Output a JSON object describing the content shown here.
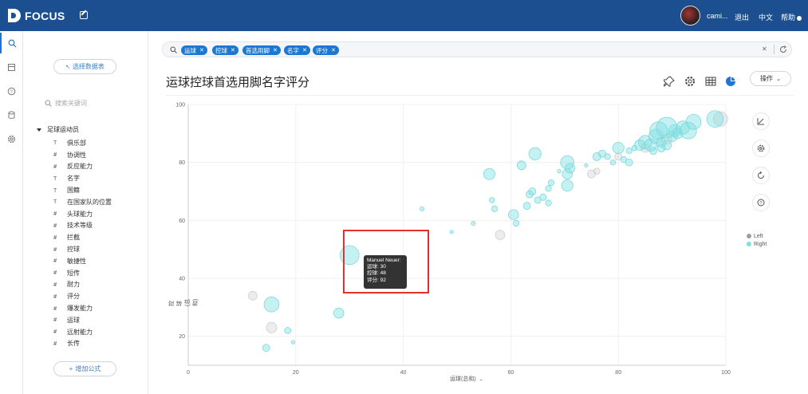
{
  "header": {
    "app_name": "FOCUS",
    "username": "cami...",
    "logout": "退出",
    "language": "中文",
    "help": "帮助"
  },
  "sidebar": {
    "select_table_button": "选择数据表",
    "search_placeholder": "搜索关键词",
    "root_label": "足球运动员",
    "fields": [
      {
        "icon": "T",
        "label": "俱乐部"
      },
      {
        "icon": "#",
        "label": "协调性"
      },
      {
        "icon": "#",
        "label": "反应能力"
      },
      {
        "icon": "T",
        "label": "名字"
      },
      {
        "icon": "T",
        "label": "国籍"
      },
      {
        "icon": "T",
        "label": "在国家队的位置"
      },
      {
        "icon": "#",
        "label": "头球能力"
      },
      {
        "icon": "#",
        "label": "技术等级"
      },
      {
        "icon": "#",
        "label": "拦截"
      },
      {
        "icon": "#",
        "label": "控球"
      },
      {
        "icon": "#",
        "label": "敏捷性"
      },
      {
        "icon": "#",
        "label": "短传"
      },
      {
        "icon": "#",
        "label": "耐力"
      },
      {
        "icon": "#",
        "label": "评分"
      },
      {
        "icon": "#",
        "label": "爆发能力"
      },
      {
        "icon": "#",
        "label": "运球"
      },
      {
        "icon": "#",
        "label": "远射能力"
      },
      {
        "icon": "#",
        "label": "长传"
      }
    ],
    "add_formula_button": "增加公式"
  },
  "search": {
    "chips": [
      "运球",
      "控球",
      "首选用脚",
      "名字",
      "评分"
    ]
  },
  "page": {
    "title": "运球控球首选用脚名字评分",
    "operate_button": "操作"
  },
  "tooltip": {
    "name": "Manuel Neuer:",
    "line1": "运球: 30",
    "line2": "控球: 48",
    "line3": "评分: 92"
  },
  "colors": {
    "header_bg": "#1c4f8f",
    "accent": "#1c77d4",
    "left": "#bdbdbd",
    "right": "#7fe0e3",
    "highlight": "#e5312d"
  },
  "chart_data": {
    "type": "scatter",
    "title": "",
    "xlabel": "运球(总和)",
    "ylabel": "控球(总和)",
    "xlim": [
      0,
      100
    ],
    "ylim": [
      10,
      100
    ],
    "x_ticks": [
      0,
      20,
      40,
      60,
      80,
      100
    ],
    "y_ticks": [
      20,
      40,
      60,
      80,
      100
    ],
    "grid": true,
    "legend_position": "right",
    "size_field": "评分",
    "series": [
      {
        "name": "Left",
        "points": [
          {
            "x": 12,
            "y": 34,
            "s": 72
          },
          {
            "x": 15.5,
            "y": 23,
            "s": 76
          },
          {
            "x": 58,
            "y": 55,
            "s": 74
          },
          {
            "x": 75,
            "y": 76,
            "s": 70
          },
          {
            "x": 76,
            "y": 77,
            "s": 65
          },
          {
            "x": 80,
            "y": 82,
            "s": 68
          },
          {
            "x": 85,
            "y": 85,
            "s": 72
          },
          {
            "x": 89,
            "y": 88,
            "s": 75
          },
          {
            "x": 99,
            "y": 95,
            "s": 84
          }
        ]
      },
      {
        "name": "Right",
        "points": [
          {
            "x": 30,
            "y": 48,
            "s": 92
          },
          {
            "x": 15.5,
            "y": 31,
            "s": 85
          },
          {
            "x": 18.5,
            "y": 22,
            "s": 65
          },
          {
            "x": 14.5,
            "y": 16,
            "s": 68
          },
          {
            "x": 19.5,
            "y": 18,
            "s": 55
          },
          {
            "x": 28,
            "y": 28,
            "s": 75
          },
          {
            "x": 43.5,
            "y": 64,
            "s": 58
          },
          {
            "x": 49,
            "y": 56,
            "s": 52
          },
          {
            "x": 53,
            "y": 59,
            "s": 57
          },
          {
            "x": 56,
            "y": 76,
            "s": 78
          },
          {
            "x": 56.5,
            "y": 67,
            "s": 62
          },
          {
            "x": 57,
            "y": 64,
            "s": 64
          },
          {
            "x": 60.5,
            "y": 62,
            "s": 75
          },
          {
            "x": 61,
            "y": 59,
            "s": 64
          },
          {
            "x": 62,
            "y": 79,
            "s": 72
          },
          {
            "x": 63,
            "y": 65,
            "s": 68
          },
          {
            "x": 63.5,
            "y": 69,
            "s": 68
          },
          {
            "x": 64,
            "y": 70,
            "s": 68
          },
          {
            "x": 64.5,
            "y": 83,
            "s": 80
          },
          {
            "x": 65,
            "y": 67,
            "s": 66
          },
          {
            "x": 66,
            "y": 68,
            "s": 66
          },
          {
            "x": 67,
            "y": 66,
            "s": 64
          },
          {
            "x": 67,
            "y": 71,
            "s": 64
          },
          {
            "x": 67.5,
            "y": 73,
            "s": 64
          },
          {
            "x": 69,
            "y": 77,
            "s": 55
          },
          {
            "x": 70.5,
            "y": 72,
            "s": 78
          },
          {
            "x": 70.5,
            "y": 76,
            "s": 75
          },
          {
            "x": 71,
            "y": 78,
            "s": 74
          },
          {
            "x": 70.5,
            "y": 80,
            "s": 82
          },
          {
            "x": 74,
            "y": 79,
            "s": 52
          },
          {
            "x": 76,
            "y": 82,
            "s": 70
          },
          {
            "x": 77,
            "y": 83,
            "s": 68
          },
          {
            "x": 78,
            "y": 82,
            "s": 64
          },
          {
            "x": 79,
            "y": 80,
            "s": 62
          },
          {
            "x": 80,
            "y": 85,
            "s": 78
          },
          {
            "x": 81,
            "y": 81,
            "s": 64
          },
          {
            "x": 82,
            "y": 80,
            "s": 68
          },
          {
            "x": 82,
            "y": 84,
            "s": 64
          },
          {
            "x": 83,
            "y": 85,
            "s": 62
          },
          {
            "x": 84,
            "y": 86,
            "s": 76
          },
          {
            "x": 85,
            "y": 87,
            "s": 82
          },
          {
            "x": 86,
            "y": 86,
            "s": 80
          },
          {
            "x": 86.5,
            "y": 84,
            "s": 68
          },
          {
            "x": 87,
            "y": 89,
            "s": 84
          },
          {
            "x": 87.5,
            "y": 91,
            "s": 90
          },
          {
            "x": 88,
            "y": 87,
            "s": 74
          },
          {
            "x": 88,
            "y": 85,
            "s": 70
          },
          {
            "x": 89,
            "y": 86,
            "s": 74
          },
          {
            "x": 90,
            "y": 89,
            "s": 76
          },
          {
            "x": 90.5,
            "y": 91,
            "s": 80
          },
          {
            "x": 91,
            "y": 90,
            "s": 76
          },
          {
            "x": 92,
            "y": 92,
            "s": 82
          },
          {
            "x": 93,
            "y": 91,
            "s": 88
          },
          {
            "x": 94,
            "y": 94,
            "s": 85
          },
          {
            "x": 98,
            "y": 95,
            "s": 88
          },
          {
            "x": 89,
            "y": 92,
            "s": 95
          }
        ]
      }
    ]
  }
}
